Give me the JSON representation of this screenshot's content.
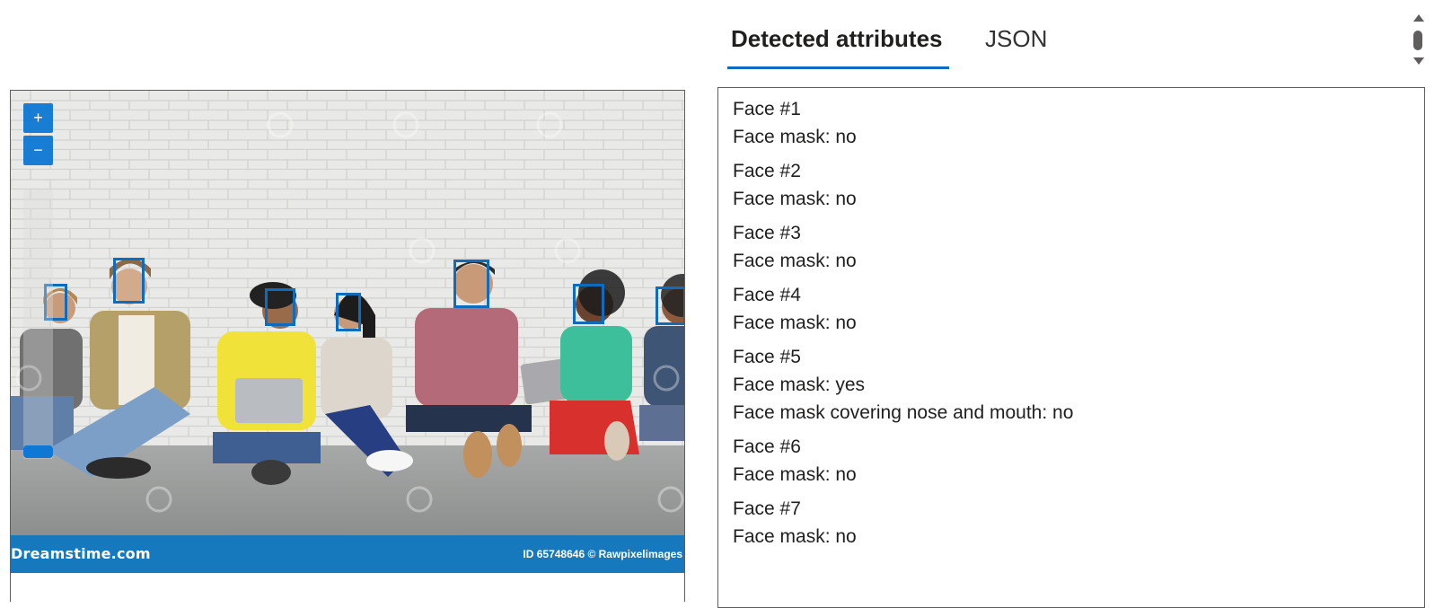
{
  "tabs": {
    "detected_label": "Detected attributes",
    "json_label": "JSON"
  },
  "viewer": {
    "zoom_in": "+",
    "zoom_out": "−",
    "watermark_left": "Dreamstime.com",
    "watermark_right": "ID 65748646 © Rawpixelimages",
    "detected_face_count": 7
  },
  "results": [
    {
      "title": "Face #1",
      "lines": [
        "Face mask: no"
      ]
    },
    {
      "title": "Face #2",
      "lines": [
        "Face mask: no"
      ]
    },
    {
      "title": "Face #3",
      "lines": [
        "Face mask: no"
      ]
    },
    {
      "title": "Face #4",
      "lines": [
        "Face mask: no"
      ]
    },
    {
      "title": "Face #5",
      "lines": [
        "Face mask: yes",
        "Face mask covering nose and mouth: no"
      ]
    },
    {
      "title": "Face #6",
      "lines": [
        "Face mask: no"
      ]
    },
    {
      "title": "Face #7",
      "lines": [
        "Face mask: no"
      ]
    }
  ],
  "colors": {
    "accent": "#0f6cbd",
    "button": "#0f78d4",
    "watermark_bar": "#1679bd"
  }
}
